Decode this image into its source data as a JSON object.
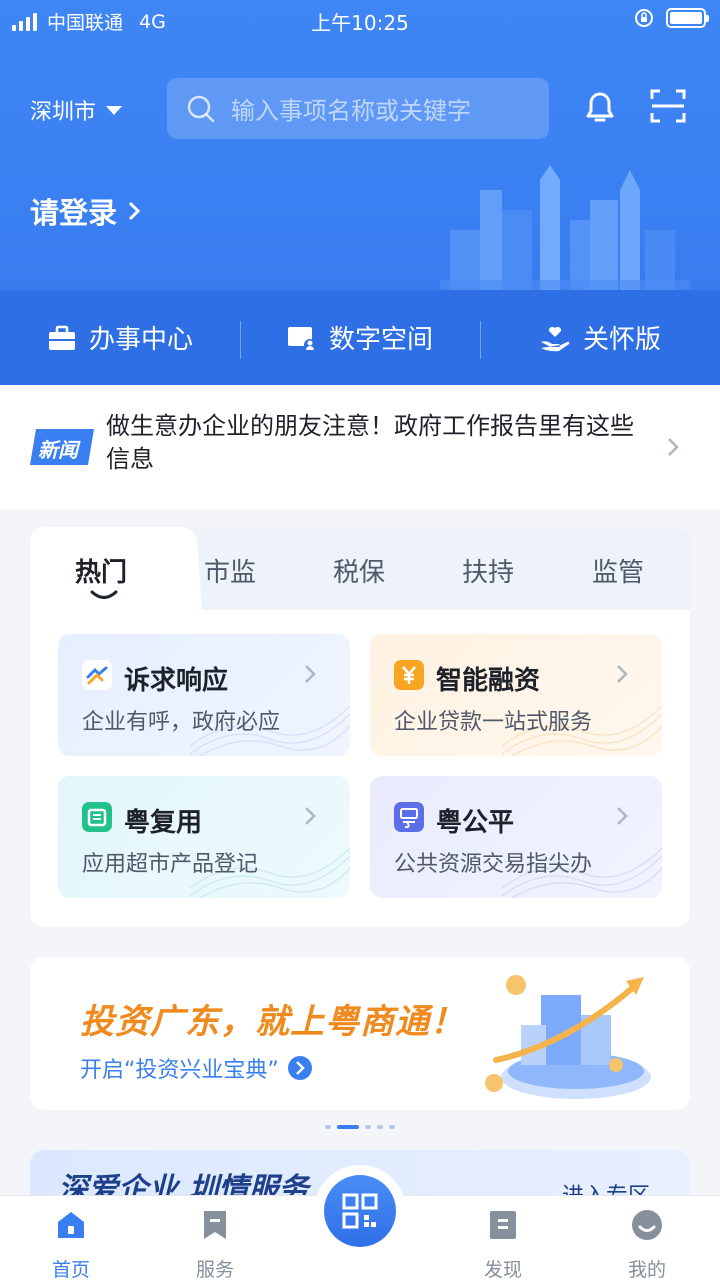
{
  "status": {
    "carrier": "中国联通",
    "network": "4G",
    "time": "上午10:25"
  },
  "header": {
    "city": "深圳市",
    "search_placeholder": "输入事项名称或关键字",
    "login": "请登录"
  },
  "quick_links": [
    "办事中心",
    "数字空间",
    "关怀版"
  ],
  "news": {
    "tag": "新闻",
    "text": "做生意办企业的朋友注意！政府工作报告里有这些信息"
  },
  "tabs": {
    "items": [
      "热门",
      "市监",
      "税保",
      "扶持",
      "监管"
    ],
    "active": "热门"
  },
  "services": [
    {
      "title": "诉求响应",
      "desc": "企业有呼，政府必应",
      "icon": "handshake-icon",
      "color": "#3a7ff1"
    },
    {
      "title": "智能融资",
      "desc": "企业贷款一站式服务",
      "icon": "yuan-icon",
      "color": "#f6a623"
    },
    {
      "title": "粤复用",
      "desc": "应用超市产品登记",
      "icon": "shop-icon",
      "color": "#22c08a"
    },
    {
      "title": "粤公平",
      "desc": "公共资源交易指尖办",
      "icon": "yue-icon",
      "color": "#5b6ee8"
    }
  ],
  "banner": {
    "slogan": "投资广东，就上粤商通！",
    "sub": "开启“投资兴业宝典”"
  },
  "promo": {
    "title": "深爱企业 圳情服务",
    "more": "进入专区"
  },
  "tabbar": {
    "items": [
      "首页",
      "服务",
      "发现",
      "我的"
    ],
    "active": "首页"
  },
  "colors": {
    "primary": "#3a7ff1",
    "orange": "#f08a1c"
  }
}
